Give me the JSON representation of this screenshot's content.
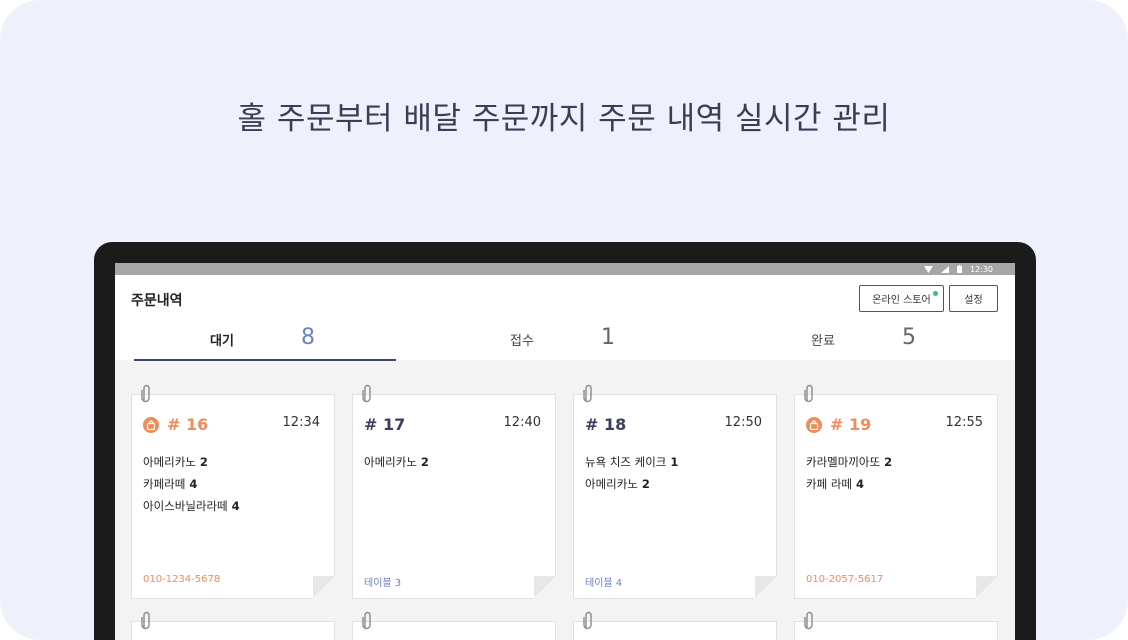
{
  "headline": "홀 주문부터 배달 주문까지 주문 내역 실시간 관리",
  "status_bar": {
    "time": "12:30",
    "icons": [
      "wifi-icon",
      "signal-icon",
      "battery-icon"
    ]
  },
  "app": {
    "title": "주문내역",
    "online_store_button": "온라인 스토어",
    "settings_button": "설정",
    "tabs": [
      {
        "label": "대기",
        "count": "8",
        "active": true
      },
      {
        "label": "접수",
        "count": "1",
        "active": false
      },
      {
        "label": "완료",
        "count": "5",
        "active": false
      }
    ]
  },
  "colors": {
    "accent_blue": "#6b80c6",
    "delivery_orange": "#ee8c5c",
    "online_dot": "#2ec27e"
  },
  "orders": [
    {
      "number": "# 16",
      "time": "12:34",
      "delivery": true,
      "items": [
        {
          "name": "아메리카노",
          "qty": "2"
        },
        {
          "name": "카페라떼",
          "qty": "4"
        },
        {
          "name": "아이스바닐라라떼",
          "qty": "4"
        }
      ],
      "footer": "010-1234-5678"
    },
    {
      "number": "# 17",
      "time": "12:40",
      "delivery": false,
      "items": [
        {
          "name": "아메리카노",
          "qty": "2"
        }
      ],
      "footer": "테이블 3"
    },
    {
      "number": "# 18",
      "time": "12:50",
      "delivery": false,
      "items": [
        {
          "name": "뉴욕 치즈 케이크",
          "qty": "1"
        },
        {
          "name": "아메리카노",
          "qty": "2"
        }
      ],
      "footer": "테이블 4"
    },
    {
      "number": "# 19",
      "time": "12:55",
      "delivery": true,
      "items": [
        {
          "name": "카라멜마끼아또",
          "qty": "2"
        },
        {
          "name": "카페 라떼",
          "qty": "4"
        }
      ],
      "footer": "010-2057-5617"
    }
  ]
}
